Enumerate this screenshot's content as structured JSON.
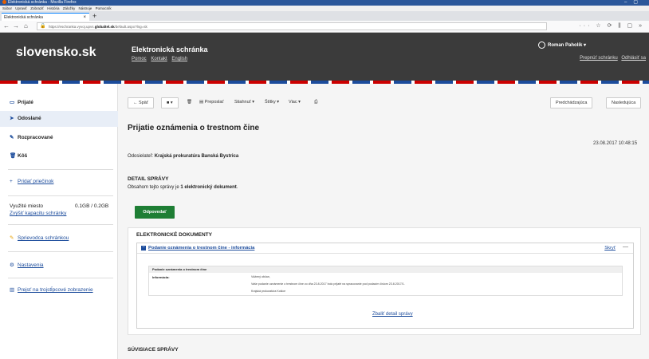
{
  "browser": {
    "window_title": "Elektronická schránka - Mozilla Firefox",
    "menu": [
      "Súbor",
      "Upraviť",
      "Zobraziť",
      "História",
      "Záložky",
      "Nástroje",
      "Pomocník"
    ],
    "tab_title": "Elektronická schránka",
    "url_prefix": "https://eschranka.vyvoj.upvs.",
    "url_domain": "globaltel.sk",
    "url_suffix": "/default.aspx?lng=sk"
  },
  "header": {
    "logo": "slovensko.sk",
    "app_title": "Elektronická schránka",
    "links": [
      "Pomoc",
      "Kontakt",
      "English"
    ],
    "user_name": "Roman Paholík",
    "user_caret": "▾",
    "switch_box": "Prepnúť schránku",
    "logout": "Odhlásiť sa"
  },
  "sidebar": {
    "items": [
      {
        "label": "Prijaté",
        "icon": "inbox-icon",
        "glyph": "▭"
      },
      {
        "label": "Odoslané",
        "icon": "send-icon",
        "glyph": "➤"
      },
      {
        "label": "Rozpracované",
        "icon": "pencil-icon",
        "glyph": "✎"
      },
      {
        "label": "Kôš",
        "icon": "trash-icon",
        "glyph": "🗑"
      }
    ],
    "add_folder": "Pridať priečinok",
    "storage_label": "Využité miesto",
    "storage_value": "0.1GB / 0.2GB",
    "increase_capacity": "Zvýšiť kapacitu schránky",
    "guide": "Sprievodca schránkou",
    "settings": "Nastavenia",
    "switch_view": "Prejsť na trojstĺpcové zobrazenie"
  },
  "toolbar": {
    "back": "← Späť",
    "folder": "▾",
    "delete": "🗑",
    "forward": "Preposlať",
    "download": "Stiahnuť ▾",
    "labels": "Štítky ▾",
    "more": "Viac ▾",
    "print": "⎙",
    "previous": "Predchádzajúca",
    "next": "Nasledujúca"
  },
  "message": {
    "title": "Prijatie oznámenia o trestnom čine",
    "date": "23.08.2017 10:48:15",
    "sender_label": "Odosielateľ:",
    "sender_name": "Krajská prokuratúra Banská Bystrica",
    "detail_title": "DETAIL SPRÁVY",
    "detail_text_pre": "Obsahom tejto správy je ",
    "detail_text_bold": "1 elektronický dokument",
    "detail_text_post": ".",
    "reply": "Odpovedať"
  },
  "documents": {
    "section_title": "ELEKTRONICKÉ DOKUMENTY",
    "doc_name": "Podanie oznámenia o trestnom čine - informácia",
    "hide": "Skryť",
    "collapse": "—",
    "inner_title": "Podanie oznámenia o trestnom čine",
    "info_label": "Informácia:",
    "lines": [
      "Vážený občan,",
      "Vaše podanie oznámenie o trestnom čine zo dňa 23.8.2017 bolo prijaté na spracovanie pod podacím číslom 23.8.2017/1.",
      "Krajská prokuratúra Košice"
    ],
    "show_detail": "Zbaliť detail správy"
  },
  "related_title": "SÚVISIACE SPRÁVY"
}
